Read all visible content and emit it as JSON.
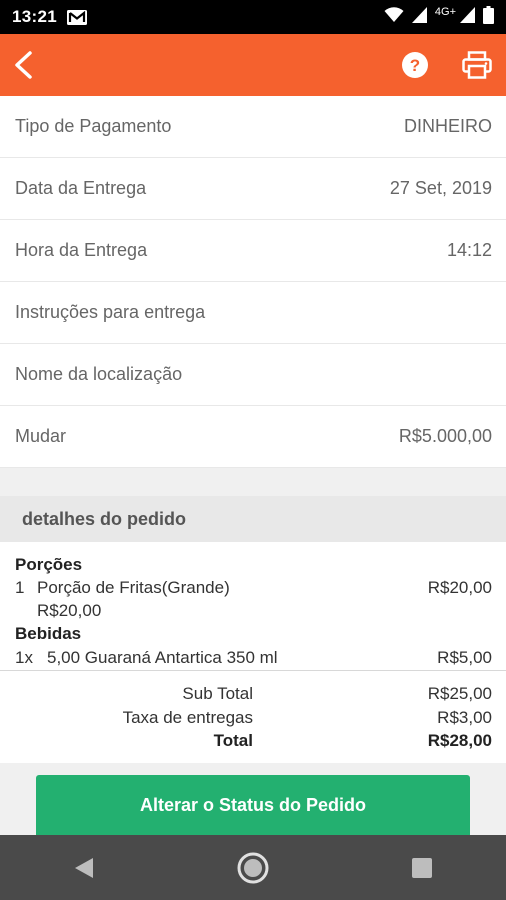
{
  "status_bar": {
    "time": "13:21",
    "network": "4G+"
  },
  "app_bar": {
    "color": "#f5612e"
  },
  "info_rows": [
    {
      "label": "Tipo de Pagamento",
      "value": "DINHEIRO"
    },
    {
      "label": "Data da Entrega",
      "value": "27 Set, 2019"
    },
    {
      "label": "Hora da Entrega",
      "value": "14:12"
    },
    {
      "label": "Instruções para entrega",
      "value": ""
    },
    {
      "label": "Nome da localização",
      "value": ""
    },
    {
      "label": "Mudar",
      "value": "R$5.000,00"
    }
  ],
  "order_section": {
    "title": "detalhes do pedido",
    "categories": [
      {
        "name": "Porções",
        "items": [
          {
            "qty": "1",
            "name": "Porção de Fritas(Grande)",
            "price": "R$20,00",
            "unit_price": "R$20,00"
          }
        ]
      },
      {
        "name": "Bebidas",
        "items": [
          {
            "qty": "1x",
            "name": "5,00 Guaraná Antartica 350 ml",
            "price": "R$5,00"
          }
        ]
      }
    ]
  },
  "totals": {
    "subtotal_label": "Sub Total",
    "subtotal_value": "R$25,00",
    "delivery_label": "Taxa de entregas",
    "delivery_value": "R$3,00",
    "total_label": "Total",
    "total_value": "R$28,00"
  },
  "action_button": {
    "label": "Alterar o Status do Pedido",
    "color": "#23b070"
  }
}
